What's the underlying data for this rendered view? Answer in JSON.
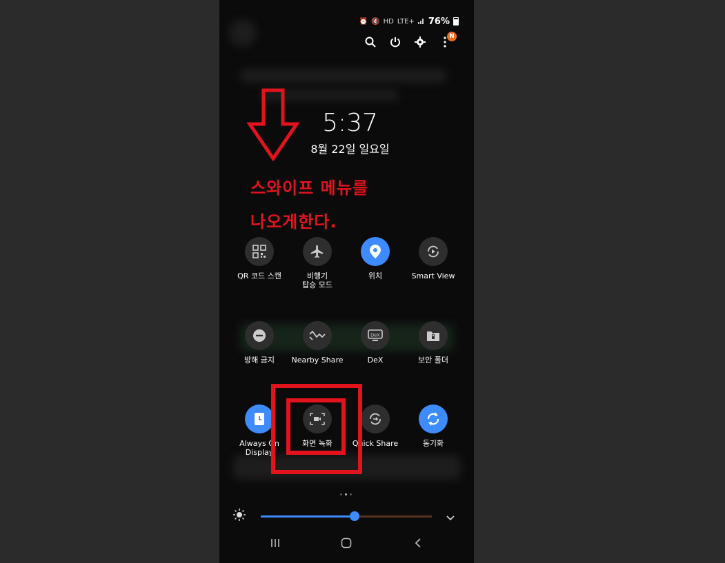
{
  "status_bar": {
    "network": "LTE+",
    "hd": "HD",
    "battery_percent": "76%",
    "battery_level": 0.76
  },
  "top_icons": {
    "notification_badge": "N"
  },
  "clock": {
    "time": "5:37",
    "date": "8월 22일 일요일"
  },
  "annotation": {
    "line1": "스와이프 메뉴를",
    "line2": "나오게한다."
  },
  "tiles": [
    {
      "label": "QR 코드 스캔",
      "icon": "qr-code-icon",
      "active": false
    },
    {
      "label": "비행기\n탑승 모드",
      "icon": "airplane-icon",
      "active": false
    },
    {
      "label": "위치",
      "icon": "location-pin-icon",
      "active": true
    },
    {
      "label": "Smart View",
      "icon": "smart-view-icon",
      "active": false
    },
    {
      "label": "방해 금지",
      "icon": "do-not-disturb-icon",
      "active": false
    },
    {
      "label": "Nearby Share",
      "icon": "nearby-share-icon",
      "active": false
    },
    {
      "label": "DeX",
      "icon": "dex-icon",
      "active": false
    },
    {
      "label": "보안 폴더",
      "icon": "secure-folder-icon",
      "active": false
    },
    {
      "label": "Always On\nDisplay",
      "icon": "always-on-display-icon",
      "active": true
    },
    {
      "label": "화면 녹화",
      "icon": "screen-record-icon",
      "active": false
    },
    {
      "label": "Quick Share",
      "icon": "quick-share-icon",
      "active": false
    },
    {
      "label": "동기화",
      "icon": "sync-icon",
      "active": true
    }
  ],
  "page_indicator": {
    "pages": 3,
    "current": 2
  },
  "brightness": {
    "level": 0.55
  },
  "colors": {
    "accent": "#3e8bff",
    "annotation_red": "#e3131d",
    "badge_orange": "#f26b1d"
  }
}
